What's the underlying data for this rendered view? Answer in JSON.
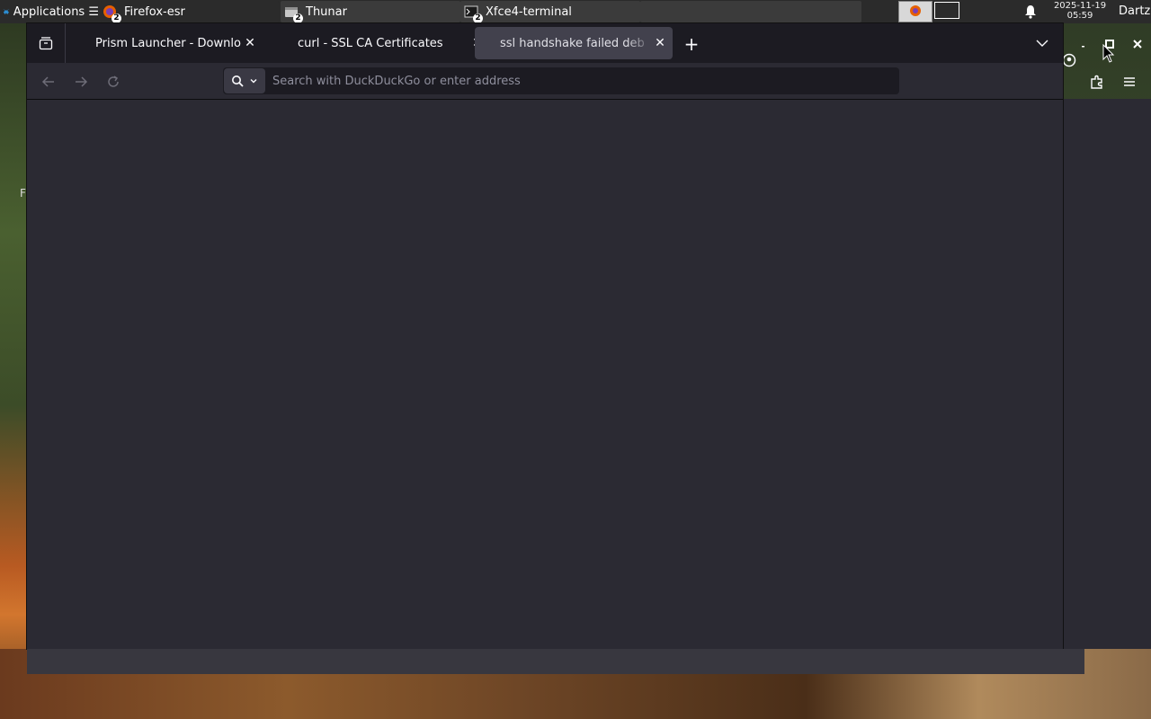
{
  "panel": {
    "applications_label": "Applications ☰",
    "tasks": [
      {
        "label": "Firefox-esr",
        "icon": "firefox-icon",
        "badge": "2"
      },
      {
        "label": "Thunar",
        "icon": "file-manager-icon",
        "badge": "2"
      },
      {
        "label": "Xfce4-terminal",
        "icon": "terminal-icon",
        "badge": "2"
      }
    ],
    "clock_date": "2025-11-19",
    "clock_time": "05:59",
    "user": "Dartz"
  },
  "desktop": {
    "partial_label": "F"
  },
  "browser": {
    "tabs": [
      {
        "title": "Prism Launcher - Downlo",
        "active": false
      },
      {
        "title": "curl - SSL CA Certificates",
        "active": false
      },
      {
        "title": "ssl handshake failed deb",
        "active": true
      }
    ],
    "close_glyph": "✕",
    "new_tab_glyph": "+",
    "urlbar": {
      "placeholder": "Search with DuckDuckGo or enter address",
      "value": ""
    }
  },
  "colors": {
    "tab_bar": "#1c1b22",
    "toolbar": "#2b2a33",
    "active_tab": "#42414d",
    "panel": "#2b2b2b"
  }
}
